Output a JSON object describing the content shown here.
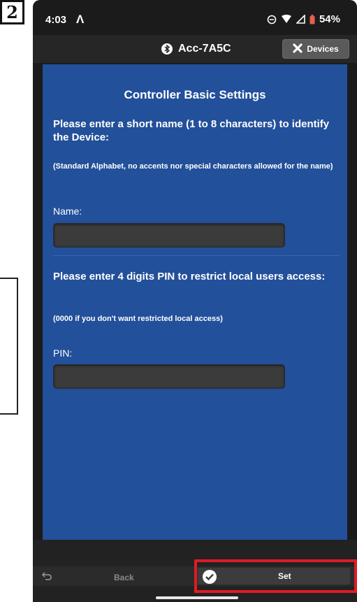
{
  "step": {
    "number": "2"
  },
  "status_bar": {
    "time": "4:03",
    "app_logo_glyph": "Λ",
    "battery": "54%"
  },
  "header": {
    "device_name": "Acc-7A5C",
    "devices_button": "Devices",
    "bluetooth_icon": "bluetooth-icon",
    "close_icon": "close-icon"
  },
  "form": {
    "title": "Controller Basic Settings",
    "name_prompt": "Please enter a short name (1 to 8 characters) to identify the Device:",
    "name_note": "(Standard Alphabet, no accents nor special characters allowed for the name)",
    "name_label": "Name:",
    "name_value": "",
    "pin_prompt": "Please enter 4 digits PIN to restrict local users access:",
    "pin_note": "(0000 if you don't want restricted local access)",
    "pin_label": "PIN:",
    "pin_value": ""
  },
  "footer": {
    "back_label": "Back",
    "set_label": "Set"
  },
  "colors": {
    "content_background": "#23509a",
    "highlight": "#e01b24",
    "header": "#262626"
  }
}
